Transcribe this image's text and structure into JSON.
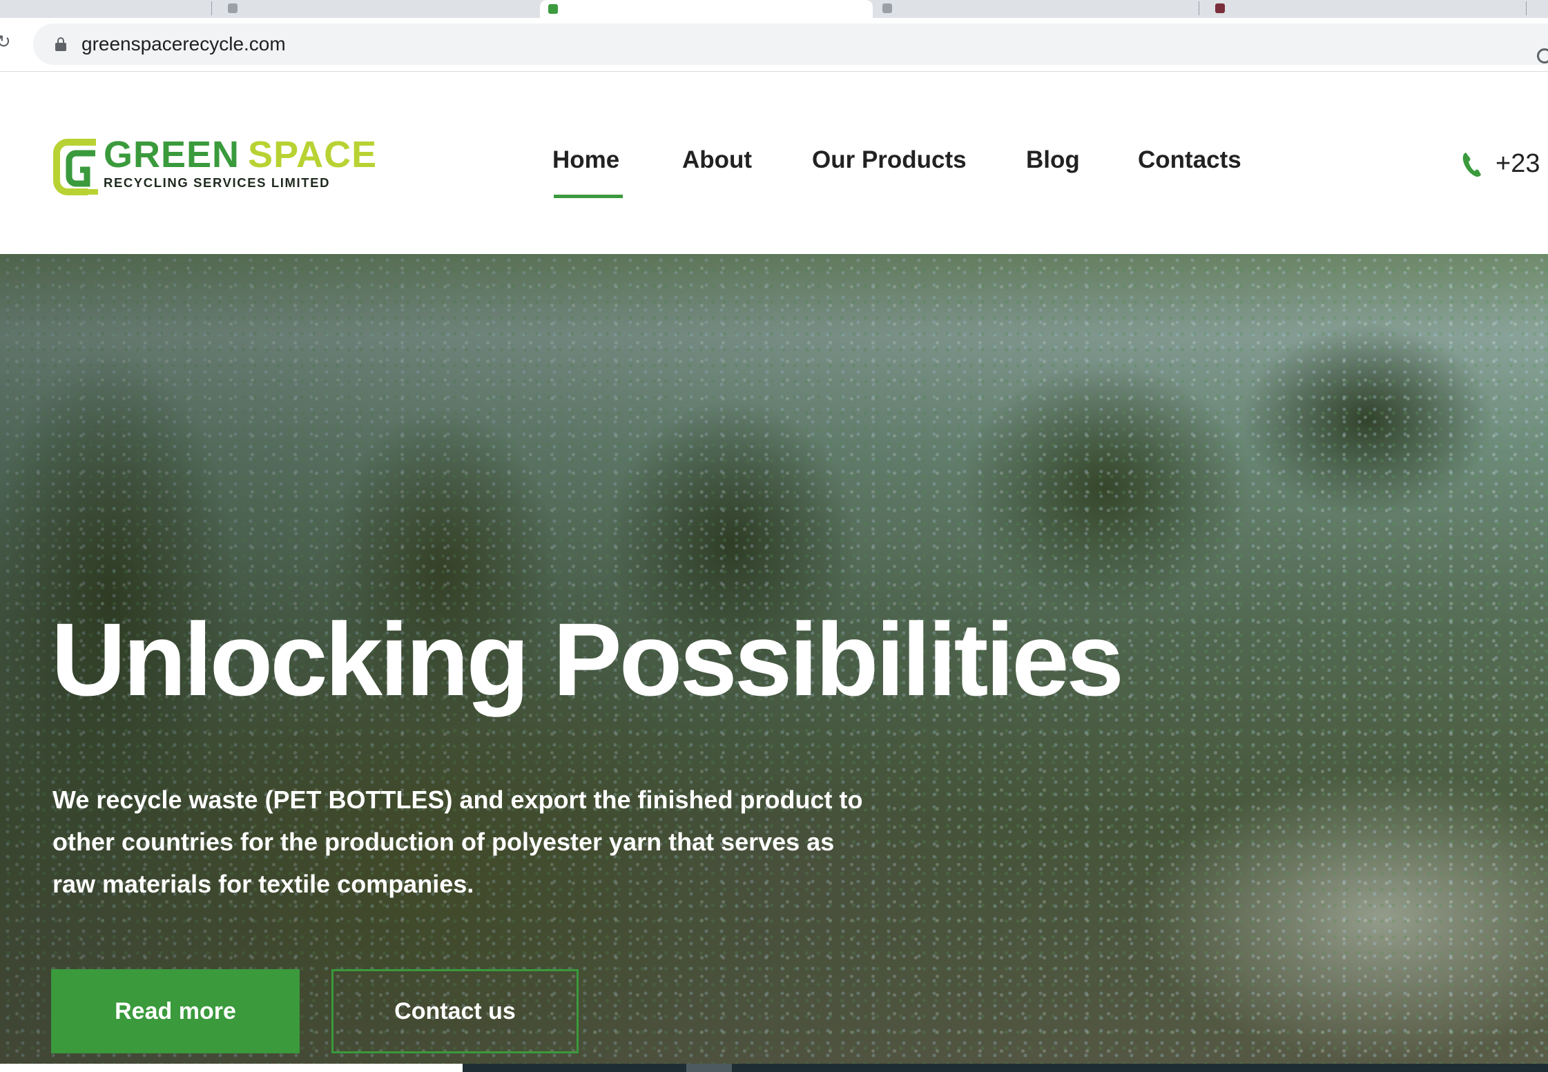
{
  "browser": {
    "url": "greenspacerecycle.com",
    "tabs": [
      {
        "label": ""
      },
      {
        "label": ""
      },
      {
        "label": "",
        "active": true
      },
      {
        "label": ""
      },
      {
        "label": ""
      }
    ]
  },
  "site": {
    "logo": {
      "name_part1": "GREEN",
      "name_part2": "SPACE",
      "subtitle": "RECYCLING SERVICES LIMITED"
    },
    "nav": [
      {
        "label": "Home",
        "active": true
      },
      {
        "label": "About"
      },
      {
        "label": "Our Products"
      },
      {
        "label": "Blog"
      },
      {
        "label": "Contacts"
      }
    ],
    "phone": "+23"
  },
  "hero": {
    "title": "Unlocking Possibilities",
    "text": "We recycle waste (PET BOTTLES) and export the finished product to other countries for the production of polyester yarn that serves as raw materials for textile companies.",
    "primary_button": "Read more",
    "secondary_button": "Contact us"
  },
  "colors": {
    "brand_green": "#3a9a3c",
    "brand_lime": "#b9d233"
  },
  "icons": {
    "reload": "reload-icon",
    "lock": "lock-icon",
    "phone": "phone-icon"
  }
}
